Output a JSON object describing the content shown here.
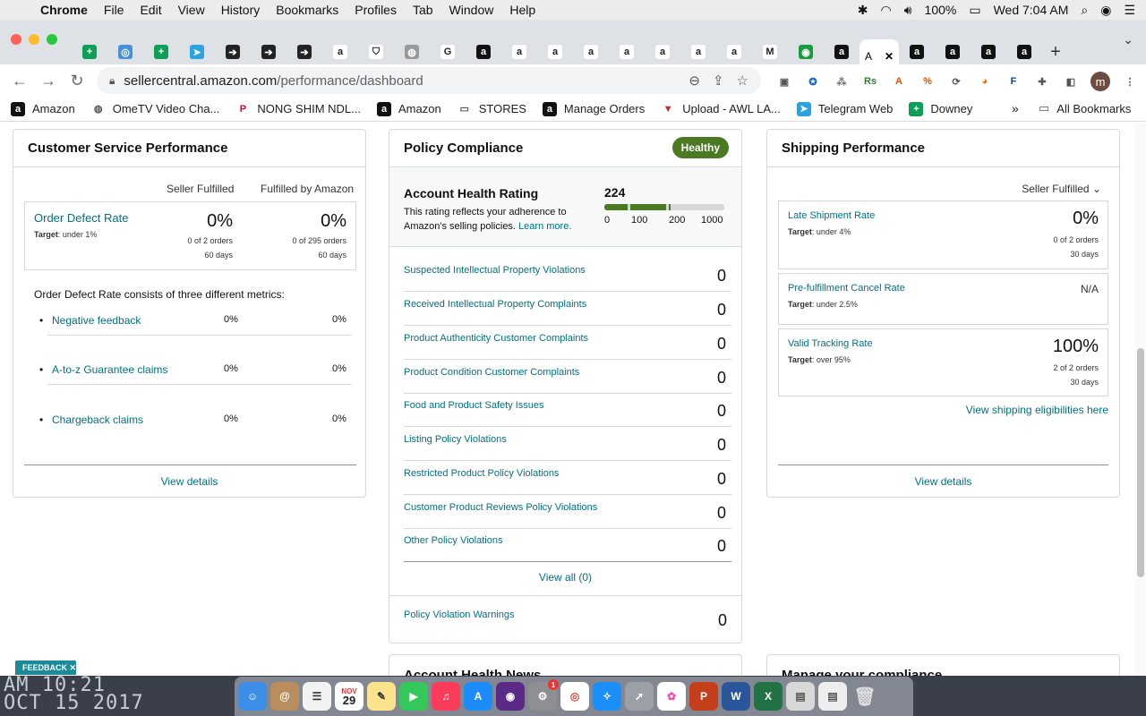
{
  "menubar": {
    "app": "Chrome",
    "items": [
      "File",
      "Edit",
      "View",
      "History",
      "Bookmarks",
      "Profiles",
      "Tab",
      "Window",
      "Help"
    ],
    "battery": "100%",
    "clock": "Wed 7:04 AM"
  },
  "tabs": {
    "active_label": "A",
    "favicons": [
      {
        "icon": "green-sheet-icon",
        "color": "#0f9d58",
        "glyph": "+"
      },
      {
        "icon": "globe-icon",
        "color": "#4a90d9",
        "glyph": "◎"
      },
      {
        "icon": "green-sheet-icon",
        "color": "#0f9d58",
        "glyph": "+"
      },
      {
        "icon": "telegram-icon",
        "color": "#2aa3df",
        "glyph": "➤"
      },
      {
        "icon": "circle-arrow-icon",
        "color": "#222222",
        "glyph": "➔"
      },
      {
        "icon": "circle-arrow-icon",
        "color": "#222222",
        "glyph": "➔"
      },
      {
        "icon": "circle-arrow-icon",
        "color": "#222222",
        "glyph": "➔"
      },
      {
        "icon": "amazon-icon",
        "color": "#ffffff",
        "glyph": "a"
      },
      {
        "icon": "shield-icon",
        "color": "#ffffff",
        "glyph": "⛉"
      },
      {
        "icon": "globe-icon",
        "color": "#999999",
        "glyph": "◍"
      },
      {
        "icon": "google-icon",
        "color": "#ffffff",
        "glyph": "G"
      },
      {
        "icon": "amazon-icon",
        "color": "#111111",
        "glyph": "a"
      },
      {
        "icon": "amazon-icon",
        "color": "#ffffff",
        "glyph": "a"
      },
      {
        "icon": "amazon-icon",
        "color": "#ffffff",
        "glyph": "a"
      },
      {
        "icon": "amazon-icon",
        "color": "#ffffff",
        "glyph": "a"
      },
      {
        "icon": "amazon-icon",
        "color": "#ffffff",
        "glyph": "a"
      },
      {
        "icon": "amazon-icon",
        "color": "#ffffff",
        "glyph": "a"
      },
      {
        "icon": "amazon-icon",
        "color": "#ffffff",
        "glyph": "a"
      },
      {
        "icon": "amazon-icon",
        "color": "#ffffff",
        "glyph": "a"
      },
      {
        "icon": "gmail-icon",
        "color": "#ffffff",
        "glyph": "M"
      },
      {
        "icon": "green-circle-icon",
        "color": "#1a9c3e",
        "glyph": "◉"
      },
      {
        "icon": "amazon-icon",
        "color": "#111111",
        "glyph": "a"
      }
    ],
    "after_active": [
      {
        "icon": "amazon-icon",
        "color": "#111111",
        "glyph": "a"
      },
      {
        "icon": "amazon-icon",
        "color": "#111111",
        "glyph": "a"
      },
      {
        "icon": "amazon-icon",
        "color": "#111111",
        "glyph": "a"
      },
      {
        "icon": "amazon-icon",
        "color": "#111111",
        "glyph": "a"
      }
    ]
  },
  "address": {
    "host": "sellercentral.amazon.com",
    "path": "/performance/dashboard"
  },
  "profile_initial": "m",
  "bookmarks": [
    {
      "label": "Amazon",
      "icon": "amazon-icon"
    },
    {
      "label": "OmeTV Video Cha...",
      "icon": "globe-icon"
    },
    {
      "label": "NONG SHIM NDL...",
      "icon": "pinterest-icon"
    },
    {
      "label": "Amazon",
      "icon": "amazon-icon"
    },
    {
      "label": "STORES",
      "icon": "folder-icon"
    },
    {
      "label": "Manage Orders",
      "icon": "amazon-icon"
    },
    {
      "label": "Upload - AWL LA...",
      "icon": "awl-icon"
    },
    {
      "label": "Telegram Web",
      "icon": "telegram-icon"
    },
    {
      "label": "Downey",
      "icon": "green-sheet-icon"
    }
  ],
  "all_bookmarks": "All Bookmarks",
  "customer_service": {
    "title": "Customer Service Performance",
    "col_seller": "Seller Fulfilled",
    "col_fba": "Fulfilled by Amazon",
    "odr": {
      "title": "Order Defect Rate",
      "target_label": "Target",
      "target_value": ": under 1%",
      "seller_value": "0%",
      "seller_orders": "0 of 2 orders",
      "seller_days": "60 days",
      "fba_value": "0%",
      "fba_orders": "0 of 295 orders",
      "fba_days": "60 days"
    },
    "description": "Order Defect Rate consists of three different metrics:",
    "metrics": [
      {
        "label": "Negative feedback",
        "seller": "0%",
        "fba": "0%"
      },
      {
        "label": "A-to-z Guarantee claims",
        "seller": "0%",
        "fba": "0%"
      },
      {
        "label": "Chargeback claims",
        "seller": "0%",
        "fba": "0%"
      }
    ],
    "view_details": "View details"
  },
  "policy": {
    "title": "Policy Compliance",
    "status": "Healthy",
    "ahr_title": "Account Health Rating",
    "ahr_desc": "This rating reflects your adherence to Amazon's selling policies.",
    "learn_more": "Learn more.",
    "score": "224",
    "score_ticks": [
      "0",
      "100",
      "200",
      "1000"
    ],
    "violations": [
      {
        "label": "Suspected Intellectual Property Violations",
        "count": "0"
      },
      {
        "label": "Received Intellectual Property Complaints",
        "count": "0"
      },
      {
        "label": "Product Authenticity Customer Complaints",
        "count": "0"
      },
      {
        "label": "Product Condition Customer Complaints",
        "count": "0"
      },
      {
        "label": "Food and Product Safety Issues",
        "count": "0"
      },
      {
        "label": "Listing Policy Violations",
        "count": "0"
      },
      {
        "label": "Restricted Product Policy Violations",
        "count": "0"
      },
      {
        "label": "Customer Product Reviews Policy Violations",
        "count": "0"
      },
      {
        "label": "Other Policy Violations",
        "count": "0"
      }
    ],
    "view_all": "View all (0)",
    "warnings_label": "Policy Violation Warnings",
    "warnings_count": "0",
    "colors": {
      "healthy": "#4b7a23"
    }
  },
  "shipping": {
    "title": "Shipping Performance",
    "filter": "Seller Fulfilled",
    "late": {
      "title": "Late Shipment Rate",
      "target_label": "Target",
      "target_value": ": under 4%",
      "value": "0%",
      "orders": "0 of 2 orders",
      "days": "30 days"
    },
    "prefill": {
      "title": "Pre-fulfillment Cancel Rate",
      "target_label": "Target",
      "target_value": ": under 2.5%",
      "value": "N/A"
    },
    "tracking": {
      "title": "Valid Tracking Rate",
      "target_label": "Target",
      "target_value": ": over 95%",
      "value": "100%",
      "orders": "2 of 2 orders",
      "days": "30 days"
    },
    "eligibility_link": "View shipping eligibilities here",
    "view_details": "View details"
  },
  "partial_cards": {
    "left": "Account Health News",
    "right": "Manage your compliance"
  },
  "feedback": "FEEDBACK",
  "wallpaper": {
    "line1": "AM 10:21",
    "line2": "OCT 15 2017"
  },
  "dock": {
    "calendar_month": "NOV",
    "calendar_day": "29",
    "badge": "1"
  }
}
